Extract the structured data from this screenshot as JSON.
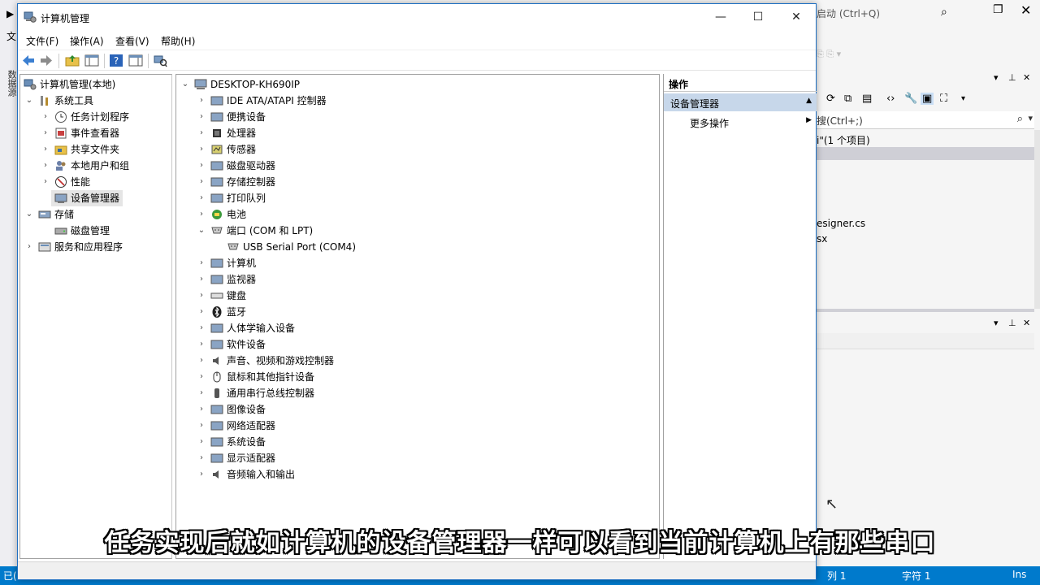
{
  "background_ide": {
    "left_glyph1": "▶",
    "left_glyph2": "文",
    "left_vertical": "数据源",
    "quick_launch": "启动 (Ctrl+Q)",
    "se_search": "搜(Ctrl+;)",
    "solution_line": "i\"(1 个项目)",
    "file1": "esigner.cs",
    "file2": "sx",
    "status_left": "已(",
    "status_col": "列 1",
    "status_char": "字符 1",
    "status_ins": "Ins"
  },
  "window": {
    "title": "计算机管理",
    "minimize_glyph": "—",
    "maximize_glyph": "☐",
    "close_glyph": "✕"
  },
  "menu": [
    "文件(F)",
    "操作(A)",
    "查看(V)",
    "帮助(H)"
  ],
  "left_tree": {
    "root": "计算机管理(本地)",
    "system_tools": "系统工具",
    "task_scheduler": "任务计划程序",
    "event_viewer": "事件查看器",
    "shared_folders": "共享文件夹",
    "local_users": "本地用户和组",
    "performance": "性能",
    "device_manager": "设备管理器",
    "storage": "存储",
    "disk_management": "磁盘管理",
    "services_apps": "服务和应用程序"
  },
  "device_tree": {
    "computer": "DESKTOP-KH690IP",
    "categories": [
      "IDE ATA/ATAPI 控制器",
      "便携设备",
      "处理器",
      "传感器",
      "磁盘驱动器",
      "存储控制器",
      "打印队列",
      "电池",
      "端口 (COM 和 LPT)",
      "USB Serial Port (COM4)",
      "计算机",
      "监视器",
      "键盘",
      "蓝牙",
      "人体学输入设备",
      "软件设备",
      "声音、视频和游戏控制器",
      "鼠标和其他指针设备",
      "通用串行总线控制器",
      "图像设备",
      "网络适配器",
      "系统设备",
      "显示适配器",
      "音频输入和输出"
    ]
  },
  "actions_pane": {
    "header": "操作",
    "section": "设备管理器",
    "more_actions": "更多操作"
  },
  "caption": "任务实现后就如计算机的设备管理器一样可以看到当前计算机上有那些串口",
  "colors": {
    "statusbar": "#007acc",
    "window_border": "#1e6fc2",
    "ops_section_bg": "#c7d7ea"
  }
}
